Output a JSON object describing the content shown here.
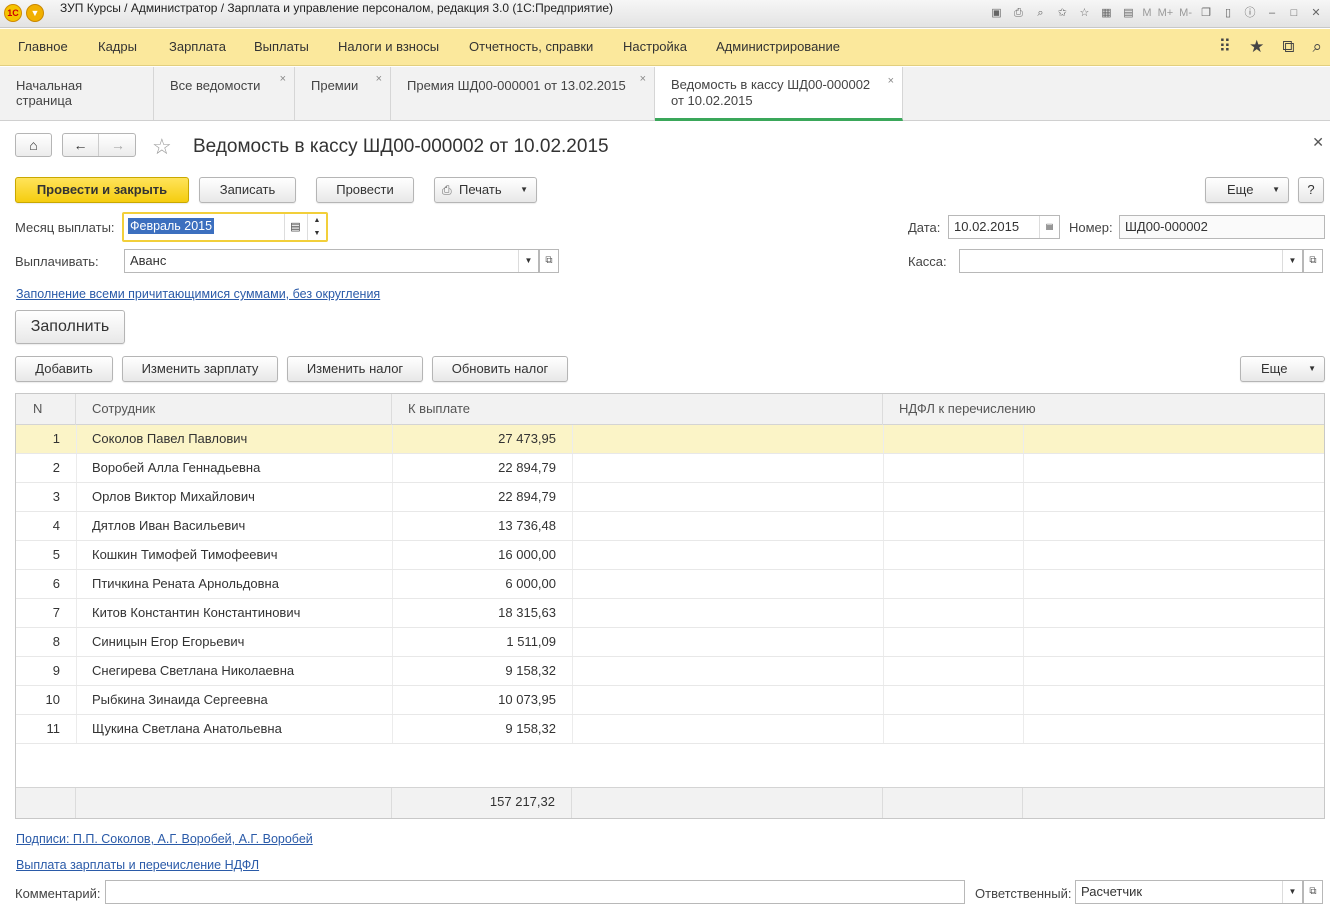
{
  "window": {
    "title": "ЗУП Курсы / Администратор / Зарплата и управление персоналом, редакция 3.0  (1С:Предприятие)",
    "logo_text": "1С",
    "toolbar_text": [
      "M",
      "M+",
      "M-"
    ]
  },
  "menu": {
    "items": [
      "Главное",
      "Кадры",
      "Зарплата",
      "Выплаты",
      "Налоги и взносы",
      "Отчетность, справки",
      "Настройка",
      "Администрирование"
    ]
  },
  "tabs": [
    {
      "label": "Начальная страница",
      "closable": false
    },
    {
      "label": "Все ведомости",
      "closable": true
    },
    {
      "label": "Премии",
      "closable": true
    },
    {
      "label": "Премия ШД00-000001 от 13.02.2015",
      "closable": true
    },
    {
      "label_line1": "Ведомость в кассу ШД00-000002",
      "label_line2": "от 10.02.2015",
      "closable": true,
      "active": true
    }
  ],
  "form": {
    "title": "Ведомость в кассу ШД00-000002 от 10.02.2015",
    "buttons": {
      "post_close": "Провести и закрыть",
      "save": "Записать",
      "post": "Провести",
      "print": "Печать",
      "more": "Еще",
      "help": "?"
    },
    "month_label": "Месяц выплаты:",
    "month_value": "Февраль 2015",
    "pay_label": "Выплачивать:",
    "pay_value": "Аванс",
    "date_label": "Дата:",
    "date_value": "10.02.2015",
    "number_label": "Номер:",
    "number_value": "ШД00-000002",
    "cash_label": "Касса:",
    "cash_value": "",
    "fill_mode_link": "Заполнение всеми причитающимися суммами, без округления",
    "fill_button": "Заполнить"
  },
  "table_toolbar": {
    "add": "Добавить",
    "change_salary": "Изменить зарплату",
    "change_tax": "Изменить налог",
    "update_tax": "Обновить налог",
    "more": "Еще"
  },
  "table": {
    "columns": [
      "N",
      "Сотрудник",
      "К выплате",
      "НДФЛ к перечислению"
    ],
    "rows": [
      {
        "n": "1",
        "name": "Соколов Павел Павлович",
        "amount": "27 473,95",
        "tax": ""
      },
      {
        "n": "2",
        "name": "Воробей Алла Геннадьевна",
        "amount": "22 894,79",
        "tax": ""
      },
      {
        "n": "3",
        "name": "Орлов Виктор Михайлович",
        "amount": "22 894,79",
        "tax": ""
      },
      {
        "n": "4",
        "name": "Дятлов Иван Васильевич",
        "amount": "13 736,48",
        "tax": ""
      },
      {
        "n": "5",
        "name": "Кошкин Тимофей Тимофеевич",
        "amount": "16 000,00",
        "tax": ""
      },
      {
        "n": "6",
        "name": "Птичкина Рената Арнольдовна",
        "amount": "6 000,00",
        "tax": ""
      },
      {
        "n": "7",
        "name": "Китов Константин Константинович",
        "amount": "18 315,63",
        "tax": ""
      },
      {
        "n": "8",
        "name": "Синицын Егор Егорьевич",
        "amount": "1 511,09",
        "tax": ""
      },
      {
        "n": "9",
        "name": "Снегирева Светлана Николаевна",
        "amount": "9 158,32",
        "tax": ""
      },
      {
        "n": "10",
        "name": "Рыбкина Зинаида Сергеевна",
        "amount": "10 073,95",
        "tax": ""
      },
      {
        "n": "11",
        "name": "Щукина Светлана Анатольевна",
        "amount": "9 158,32",
        "tax": ""
      }
    ],
    "selected_row": 0,
    "total": "157 217,32"
  },
  "footer": {
    "signatures_link": "Подписи: П.П. Соколов, А.Г. Воробей, А.Г. Воробей",
    "payment_link": "Выплата зарплаты и перечисление НДФЛ",
    "comment_label": "Комментарий:",
    "comment_value": "",
    "responsible_label": "Ответственный:",
    "responsible_value": "Расчетчик"
  },
  "colors": {
    "menu_bg": "#fbe89c",
    "primary_button": "#f5cd0f",
    "selected_row": "#fbf4c7",
    "active_tab_underline": "#3aa75a",
    "link": "#2a5aa8"
  }
}
